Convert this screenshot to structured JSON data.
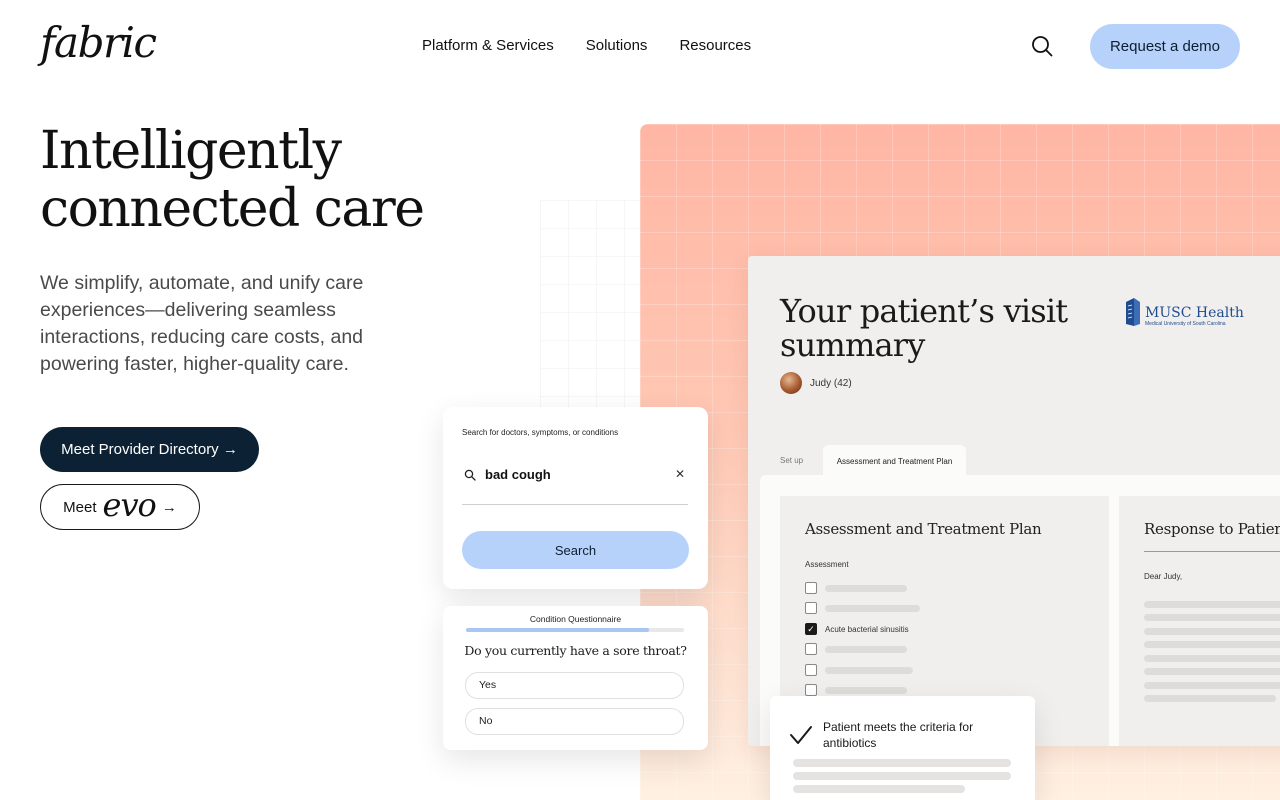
{
  "header": {
    "logo": "fabric",
    "nav": [
      "Platform & Services",
      "Solutions",
      "Resources"
    ],
    "search_icon": "search-icon",
    "cta": "Request a demo"
  },
  "hero": {
    "title_line1": "Intelligently",
    "title_line2": "connected care",
    "subtitle": "We simplify, automate, and unify care experiences—delivering seamless interactions, reducing care costs, and powering faster, higher-quality care.",
    "primary_button": "Meet Provider Directory →",
    "evo_prefix": "Meet",
    "evo_word": "evo",
    "evo_arrow": "→"
  },
  "summary_card": {
    "title": "Your patient’s visit summary",
    "org_name": "MUSC Health",
    "org_subtitle": "Medical University of South Carolina",
    "patient": "Judy (42)",
    "tabs": [
      "Set up",
      "Assessment and Treatment Plan"
    ],
    "assessment_title": "Assessment and Treatment Plan",
    "assessment_label": "Assessment",
    "checked_item": "Acute bacterial sinusitis",
    "response_title": "Response to Patient",
    "response_greeting": "Dear Judy,"
  },
  "search_card": {
    "label": "Search for doctors, symptoms, or conditions",
    "value": "bad cough",
    "clear_icon": "close-icon",
    "button": "Search"
  },
  "questionnaire": {
    "label": "Condition Questionnaire",
    "progress": 0.84,
    "question": "Do you currently have a sore throat?",
    "options": [
      "Yes",
      "No"
    ]
  },
  "criteria_card": {
    "icon": "checkmark-icon",
    "text": "Patient meets the criteria for antibiotics"
  },
  "colors": {
    "cta_blue": "#b7d2fa",
    "navy": "#0c2234",
    "peach": "#ffb6a4",
    "musc_blue": "#1f4b8f"
  }
}
